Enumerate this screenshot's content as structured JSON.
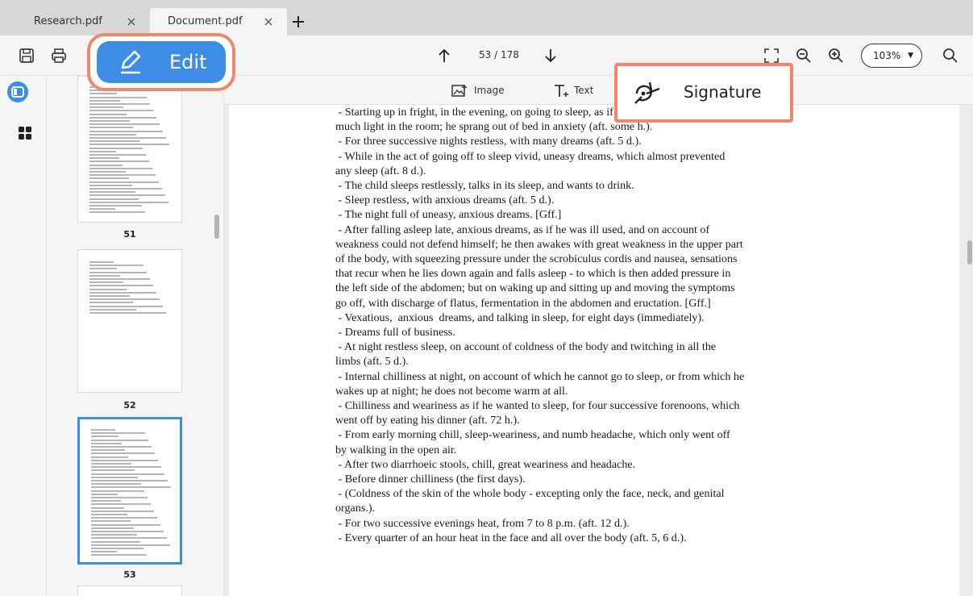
{
  "tabs": [
    {
      "label": "Research.pdf",
      "active": false
    },
    {
      "label": "Document.pdf",
      "active": true
    }
  ],
  "toolbar": {
    "page_current": "53",
    "page_sep": " / ",
    "page_total": "178",
    "zoom": "103%"
  },
  "edit_button": {
    "label": "Edit"
  },
  "subtoolbar": {
    "image_label": "Image",
    "text_label": "Text"
  },
  "signature_button": {
    "label": "Signature"
  },
  "thumbnails": [
    {
      "label": "51"
    },
    {
      "label": "52"
    },
    {
      "label": "53",
      "selected": true
    }
  ],
  "document_lines": [
    " - Starting up in fright, in the evening, on going to sleep, as if there was too",
    "much light in the room; he sprang out of bed in anxiety (aft. some h.).",
    " - For three successive nights restless, with many dreams (aft. 5 d.).",
    " - While in the act of going off to sleep vivid, uneasy dreams, which almost prevented",
    "any sleep (aft. 8 d.).",
    " - The child sleeps restlessly, talks in its sleep, and wants to drink.",
    " - Sleep restless, with anxious dreams (aft. 5 d.).",
    " - The night full of uneasy, anxious dreams. [Gff.]",
    " - After falling asleep late, anxious dreams, as if he was ill used, and on account of",
    "weakness could not defend himself; he then awakes with great weakness in the upper part",
    "of the body, with squeezing pressure under the scrobiculus cordis and nausea, sensations",
    "that recur when he lies down again and falls asleep - to which is then added pressure in",
    "the left side of the abdomen; but on waking up and sitting up and moving the symptoms",
    "go off, with discharge of flatus, fermentation in the abdomen and eructation. [Gff.]",
    " - Vexatious,  anxious  dreams, and talking in sleep, for eight days (immediately).",
    " - Dreams full of business.",
    " - At night restless sleep, on account of coldness of the body and twitching in all the",
    "limbs (aft. 5 d.).",
    " - Internal chilliness at night, on account of which he cannot go to sleep, or from which he",
    "wakes up at night; he does not become warm at all.",
    " - Chilliness and weariness as if he wanted to sleep, for four successive forenoons, which",
    "went off by eating his dinner (aft. 72 h.).",
    " - From early morning chill, sleep-weariness, and numb headache, which only went off",
    "by walking in the open air.",
    " - After two diarrhoeic stools, chill, great weariness and headache.",
    " - Before dinner chilliness (the first days).",
    " - (Coldness of the skin of the whole body - excepting only the face, neck, and genital",
    "organs.).",
    " - For two successive evenings heat, from 7 to 8 p.m. (aft. 12 d.).",
    " - Every quarter of an hour heat in the face and all over the body (aft. 5, 6 d.)."
  ],
  "colors": {
    "accent": "#3d8de6",
    "callout": "#f0876a"
  }
}
